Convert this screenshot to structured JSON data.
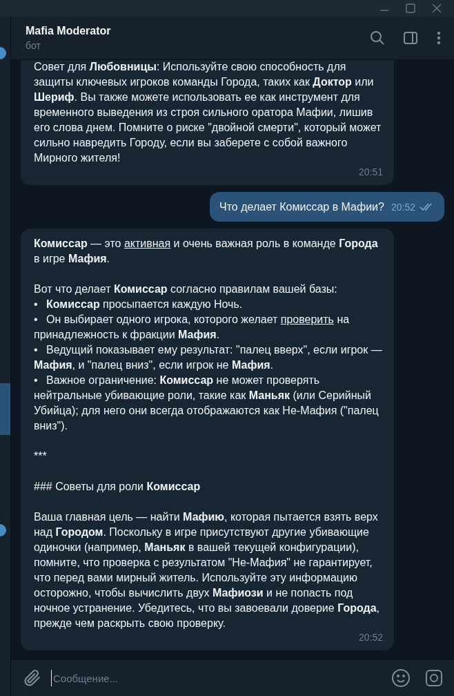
{
  "chat": {
    "title": "Mafia Moderator",
    "subtitle": "бот"
  },
  "messages": [
    {
      "outgoing": false,
      "time": "20:51",
      "blocks": [
        {
          "kind": "paragraph",
          "parts": [
            {
              "text": "Совет для **Любовницы**: Используйте свою способность для защиты ключевых игроков команды Города, таких как **Доктор** или **Шериф**. Вы также можете использовать ее как инструмент для временного выведения из строя сильного оратора Мафии, лишив его слова днем. Помните о риске \"двойной смерти\", который может сильно навредить Городу, если вы заберете с собой важного Мирного жителя!",
              "underline": false
            }
          ]
        }
      ]
    },
    {
      "outgoing": true,
      "time": "20:52",
      "read": true,
      "blocks": [
        {
          "kind": "paragraph",
          "parts": [
            {
              "text": "Что делает Комиссар в Мафии?",
              "underline": false
            }
          ]
        }
      ]
    },
    {
      "outgoing": false,
      "time": "20:52",
      "blocks": [
        {
          "kind": "paragraph",
          "parts": [
            {
              "text": "**Комиссар** — это ",
              "underline": false
            },
            {
              "text": "активная",
              "underline": true
            },
            {
              "text": " и очень важная роль в команде **Города** в игре **Мафия**.",
              "underline": false
            }
          ]
        },
        {
          "kind": "paragraph",
          "parts": [
            {
              "text": "Вот что делает **Комиссар** согласно правилам вашей базы:",
              "underline": false
            }
          ]
        },
        {
          "kind": "bullet",
          "marker": "•",
          "parts": [
            {
              "text": "**Комиссар** просыпается каждую Ночь.",
              "underline": false
            }
          ]
        },
        {
          "kind": "bullet",
          "marker": "•",
          "parts": [
            {
              "text": "Он выбирает одного игрока, которого желает ",
              "underline": false
            },
            {
              "text": "проверить",
              "underline": true
            },
            {
              "text": " на принадлежность к фракции **Мафия**.",
              "underline": false
            }
          ]
        },
        {
          "kind": "bullet",
          "marker": "•",
          "parts": [
            {
              "text": "Ведущий показывает ему результат: \"палец вверх\", если игрок — **Мафия**, и \"палец вниз\", если игрок не **Мафия**.",
              "underline": false
            }
          ]
        },
        {
          "kind": "bullet",
          "marker": "•",
          "parts": [
            {
              "text": "Важное ограничение: **Комиссар** не может проверять нейтральные убивающие роли, такие как **Маньяк** (или Серийный Убийца); для него они всегда отображаются как Не-Мафия (\"палец вниз\").",
              "underline": false
            }
          ]
        },
        {
          "kind": "paragraph",
          "parts": [
            {
              "text": "***",
              "underline": false
            }
          ]
        },
        {
          "kind": "paragraph",
          "parts": [
            {
              "text": "### Советы для роли **Комиссар**",
              "underline": false
            }
          ]
        },
        {
          "kind": "paragraph",
          "parts": [
            {
              "text": "Ваша главная цель — найти **Мафию**, которая пытается взять верх над **Городом**. Поскольку в игре присутствуют другие убивающие одиночки (например, **Маньяк** в вашей текущей конфигурации), помните, что проверка с результатом \"Не-Мафия\" не гарантирует, что перед вами мирный житель. Используйте эту информацию осторожно, чтобы вычислить двух **Мафиози** и не попасть под ночное устранение. Убедитесь, что вы завоевали доверие **Города**, прежде чем раскрыть свою проверку.",
              "underline": false
            }
          ]
        }
      ]
    }
  ],
  "composer": {
    "placeholder": "Сообщение..."
  }
}
